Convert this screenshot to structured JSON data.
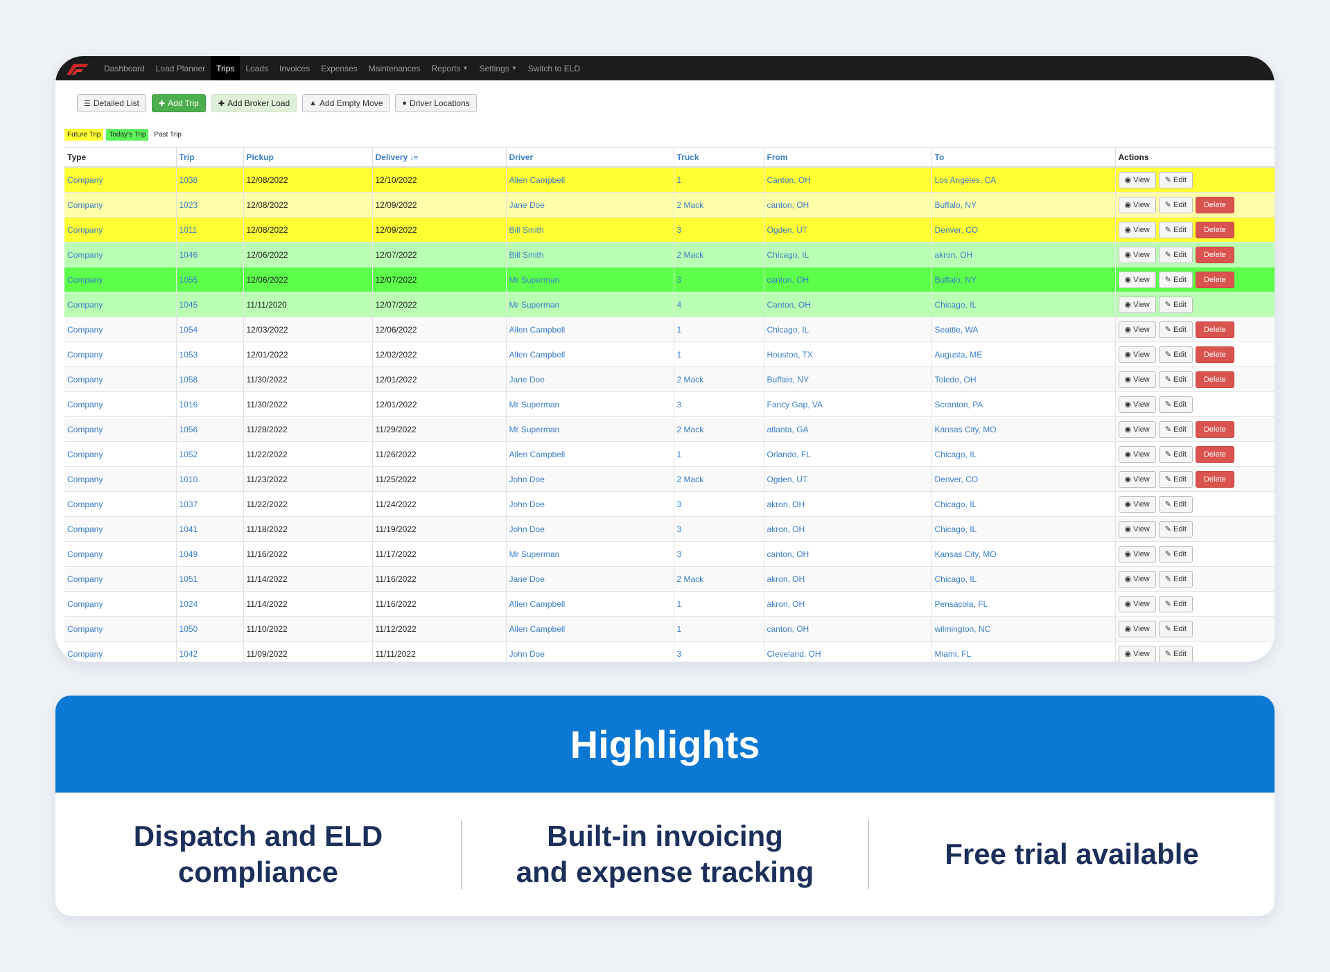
{
  "nav": {
    "items": [
      {
        "label": "Dashboard",
        "active": false,
        "dropdown": false
      },
      {
        "label": "Load Planner",
        "active": false,
        "dropdown": false
      },
      {
        "label": "Trips",
        "active": true,
        "dropdown": false
      },
      {
        "label": "Loads",
        "active": false,
        "dropdown": false
      },
      {
        "label": "Invoices",
        "active": false,
        "dropdown": false
      },
      {
        "label": "Expenses",
        "active": false,
        "dropdown": false
      },
      {
        "label": "Maintenances",
        "active": false,
        "dropdown": false
      },
      {
        "label": "Reports",
        "active": false,
        "dropdown": true
      },
      {
        "label": "Settings",
        "active": false,
        "dropdown": true
      },
      {
        "label": "Switch to ELD",
        "active": false,
        "dropdown": false
      }
    ]
  },
  "toolbar": {
    "detailed_list": "Detailed List",
    "add_trip": "Add Trip",
    "add_broker_load": "Add Broker Load",
    "add_empty_move": "Add Empty Move",
    "driver_locations": "Driver Locations"
  },
  "legend": {
    "future": "Future Trip",
    "today": "Today's Trip",
    "past": "Past Trip"
  },
  "table": {
    "columns": [
      "Type",
      "Trip",
      "Pickup",
      "Delivery",
      "Driver",
      "Truck",
      "From",
      "To",
      "Actions"
    ],
    "view_label": "View",
    "edit_label": "Edit",
    "delete_label": "Delete",
    "rows": [
      {
        "status": "future",
        "type": "Company",
        "trip": "1038",
        "pickup": "12/08/2022",
        "delivery": "12/10/2022",
        "driver": "Allen Campbell",
        "truck": "1",
        "from": "Canton, OH",
        "to": "Los Angeles, CA",
        "delete": false
      },
      {
        "status": "future-light",
        "type": "Company",
        "trip": "1023",
        "pickup": "12/08/2022",
        "delivery": "12/09/2022",
        "driver": "Jane Doe",
        "truck": "2 Mack",
        "from": "canton, OH",
        "to": "Buffalo, NY",
        "delete": true
      },
      {
        "status": "future",
        "type": "Company",
        "trip": "1011",
        "pickup": "12/08/2022",
        "delivery": "12/09/2022",
        "driver": "Bill Smith",
        "truck": "3",
        "from": "Ogden, UT",
        "to": "Denver, CO",
        "delete": true
      },
      {
        "status": "today-light",
        "type": "Company",
        "trip": "1046",
        "pickup": "12/06/2022",
        "delivery": "12/07/2022",
        "driver": "Bill Smith",
        "truck": "2 Mack",
        "from": "Chicago, IL",
        "to": "akron, OH",
        "delete": true
      },
      {
        "status": "today",
        "type": "Company",
        "trip": "1055",
        "pickup": "12/06/2022",
        "delivery": "12/07/2022",
        "driver": "Mr Superman",
        "truck": "3",
        "from": "canton, OH",
        "to": "Buffalo, NY",
        "delete": true
      },
      {
        "status": "today-light",
        "type": "Company",
        "trip": "1045",
        "pickup": "11/11/2020",
        "delivery": "12/07/2022",
        "driver": "Mr Superman",
        "truck": "4",
        "from": "Canton, OH",
        "to": "Chicago, IL",
        "delete": false
      },
      {
        "status": "past-alt",
        "type": "Company",
        "trip": "1054",
        "pickup": "12/03/2022",
        "delivery": "12/06/2022",
        "driver": "Allen Campbell",
        "truck": "1",
        "from": "Chicago, IL",
        "to": "Seattle, WA",
        "delete": true
      },
      {
        "status": "past",
        "type": "Company",
        "trip": "1053",
        "pickup": "12/01/2022",
        "delivery": "12/02/2022",
        "driver": "Allen Campbell",
        "truck": "1",
        "from": "Houston, TX",
        "to": "Augusta, ME",
        "delete": true
      },
      {
        "status": "past-alt",
        "type": "Company",
        "trip": "1058",
        "pickup": "11/30/2022",
        "delivery": "12/01/2022",
        "driver": "Jane Doe",
        "truck": "2 Mack",
        "from": "Buffalo, NY",
        "to": "Toledo, OH",
        "delete": true
      },
      {
        "status": "past",
        "type": "Company",
        "trip": "1016",
        "pickup": "11/30/2022",
        "delivery": "12/01/2022",
        "driver": "Mr Superman",
        "truck": "3",
        "from": "Fancy Gap, VA",
        "to": "Scranton, PA",
        "delete": false
      },
      {
        "status": "past-alt",
        "type": "Company",
        "trip": "1056",
        "pickup": "11/28/2022",
        "delivery": "11/29/2022",
        "driver": "Mr Superman",
        "truck": "2 Mack",
        "from": "atlanta, GA",
        "to": "Kansas City, MO",
        "delete": true
      },
      {
        "status": "past",
        "type": "Company",
        "trip": "1052",
        "pickup": "11/22/2022",
        "delivery": "11/26/2022",
        "driver": "Allen Campbell",
        "truck": "1",
        "from": "Orlando, FL",
        "to": "Chicago, IL",
        "delete": true
      },
      {
        "status": "past-alt",
        "type": "Company",
        "trip": "1010",
        "pickup": "11/23/2022",
        "delivery": "11/25/2022",
        "driver": "John Doe",
        "truck": "2 Mack",
        "from": "Ogden, UT",
        "to": "Denver, CO",
        "delete": true
      },
      {
        "status": "past",
        "type": "Company",
        "trip": "1037",
        "pickup": "11/22/2022",
        "delivery": "11/24/2022",
        "driver": "John Doe",
        "truck": "3",
        "from": "akron, OH",
        "to": "Chicago, IL",
        "delete": false
      },
      {
        "status": "past-alt",
        "type": "Company",
        "trip": "1041",
        "pickup": "11/18/2022",
        "delivery": "11/19/2022",
        "driver": "John Doe",
        "truck": "3",
        "from": "akron, OH",
        "to": "Chicago, IL",
        "delete": false
      },
      {
        "status": "past",
        "type": "Company",
        "trip": "1049",
        "pickup": "11/16/2022",
        "delivery": "11/17/2022",
        "driver": "Mr Superman",
        "truck": "3",
        "from": "canton, OH",
        "to": "Kansas City, MO",
        "delete": false
      },
      {
        "status": "past-alt",
        "type": "Company",
        "trip": "1051",
        "pickup": "11/14/2022",
        "delivery": "11/16/2022",
        "driver": "Jane Doe",
        "truck": "2 Mack",
        "from": "akron, OH",
        "to": "Chicago, IL",
        "delete": false
      },
      {
        "status": "past",
        "type": "Company",
        "trip": "1024",
        "pickup": "11/14/2022",
        "delivery": "11/16/2022",
        "driver": "Allen Campbell",
        "truck": "1",
        "from": "akron, OH",
        "to": "Pensacola, FL",
        "delete": false
      },
      {
        "status": "past-alt",
        "type": "Company",
        "trip": "1050",
        "pickup": "11/10/2022",
        "delivery": "11/12/2022",
        "driver": "Allen Campbell",
        "truck": "1",
        "from": "canton, OH",
        "to": "wilmington, NC",
        "delete": false
      },
      {
        "status": "past",
        "type": "Company",
        "trip": "1042",
        "pickup": "11/09/2022",
        "delivery": "11/11/2022",
        "driver": "John Doe",
        "truck": "3",
        "from": "Cleveland, OH",
        "to": "Miami, FL",
        "delete": false
      }
    ]
  },
  "highlights": {
    "title": "Highlights",
    "items": [
      {
        "lines": [
          "Dispatch and ELD",
          "compliance"
        ]
      },
      {
        "lines": [
          "Built-in invoicing",
          "and expense tracking"
        ]
      },
      {
        "lines": [
          "Free trial available"
        ]
      }
    ]
  },
  "colors": {
    "future": "#ffff33",
    "future_light": "#ffffaa",
    "today": "#5cff4a",
    "today_light": "#bbffb4",
    "delete": "#d9534f",
    "highlight_header": "#0b78d3"
  }
}
